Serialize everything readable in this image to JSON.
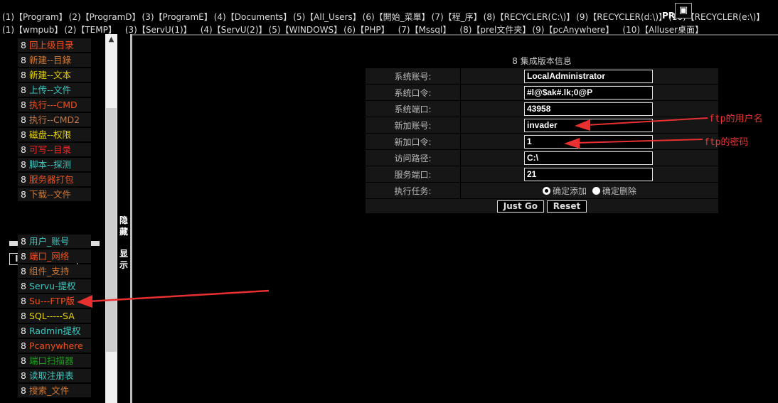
{
  "top_links_row1": [
    "(1)【Program】",
    "(2)【ProgramD】",
    "(3)【ProgramE】",
    "(4)【Documents】",
    "(5)【All_Users】",
    "(6)【開始_菜單】",
    "(7)【程_序】",
    "(8)【RECYCLER(C:\\)】",
    "(9)【RECYCLER(d:\\)】",
    "(10)【RECYCLER(e:\\)】"
  ],
  "top_links_row2": [
    "(1)【wmpub】",
    "(2)【TEMP】",
    "(3)【ServU(1)】",
    "(4)【ServU(2)】",
    "(5)【WINDOWS】",
    "(6)【PHP】",
    "(7)【Mssql】",
    "(8)【prel文件夹】",
    "(9)【pcAnywhere】",
    "(10)【Alluser桌面】"
  ],
  "pr_label": "PR:",
  "pr_icon": "broken-image-icon",
  "sidebar": {
    "bullet": "8",
    "file_items": [
      {
        "label": "回上级目录",
        "color": "#f0501e"
      },
      {
        "label": "新建--目錄",
        "color": "#d6782e"
      },
      {
        "label": "新建--文本",
        "color": "#e8d400"
      },
      {
        "label": "上传--文件",
        "color": "#3cc8c0"
      },
      {
        "label": "执行---CMD",
        "color": "#f0501e"
      },
      {
        "label": "执行--CMD2",
        "color": "#c07a48"
      },
      {
        "label": "磁盘--权限",
        "color": "#e8d400"
      },
      {
        "label": "可写--目录",
        "color": "#ff2424"
      },
      {
        "label": "脚本--探测",
        "color": "#3cc8c0"
      },
      {
        "label": "服务器打包",
        "color": "#f0501e"
      },
      {
        "label": "下载--文件",
        "color": "#d6782e"
      }
    ],
    "info_heading": "Information",
    "info_items": [
      {
        "label": "用户_账号",
        "color": "#3cc8c0"
      },
      {
        "label": "端口_网络",
        "color": "#f0501e"
      },
      {
        "label": "组件_支持",
        "color": "#d6782e"
      },
      {
        "label": "Servu-提权",
        "color": "#3cc8c0"
      },
      {
        "label": "Su---FTP版",
        "color": "#f0501e"
      },
      {
        "label": "SQL-----SA",
        "color": "#e8d400"
      },
      {
        "label": "Radmin提权",
        "color": "#3cc8c0"
      },
      {
        "label": "Pcanywhere",
        "color": "#f0501e"
      },
      {
        "label": "端口扫描器",
        "color": "#1f9a1f"
      },
      {
        "label": "读取注册表",
        "color": "#3cc8c0"
      },
      {
        "label": "搜索_文件",
        "color": "#d6782e"
      }
    ]
  },
  "toggle": {
    "hide": "隐藏",
    "show": "显示"
  },
  "form": {
    "title": "8 集成版本信息",
    "rows": [
      {
        "label": "系统账号:",
        "value": "LocalAdministrator"
      },
      {
        "label": "系统口令:",
        "value": "#l@$ak#.lk;0@P"
      },
      {
        "label": "系统端口:",
        "value": "43958"
      },
      {
        "label": "新加账号:",
        "value": "invader"
      },
      {
        "label": "新加口令:",
        "value": "1"
      },
      {
        "label": "访问路径:",
        "value": "C:\\"
      },
      {
        "label": "服务端口:",
        "value": "21"
      }
    ],
    "task_label": "执行任务:",
    "radio_add": "确定添加",
    "radio_delete": "确定删除",
    "selected": "确定添加",
    "submit": "Just Go",
    "reset": "Reset"
  },
  "annotations": {
    "username": "ftp的用户名",
    "password": "ftp的密码",
    "arrow_color": "#e83030"
  }
}
